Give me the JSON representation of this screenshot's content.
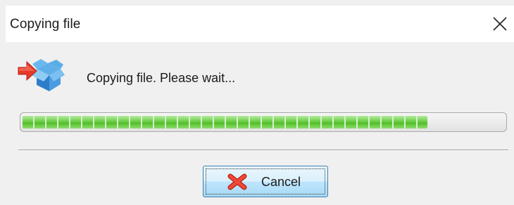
{
  "window": {
    "title": "Copying file"
  },
  "dialog": {
    "message": "Copying file. Please wait...",
    "progress": 0.84,
    "icon": "copy-box-icon"
  },
  "buttons": {
    "cancel_label": "Cancel",
    "cancel_icon": "red-x-icon"
  },
  "colors": {
    "progress_green": "#4fbd27",
    "button_border": "#3c7fb1",
    "icon_blue": "#3a8fd6",
    "icon_red": "#e53a2a"
  }
}
